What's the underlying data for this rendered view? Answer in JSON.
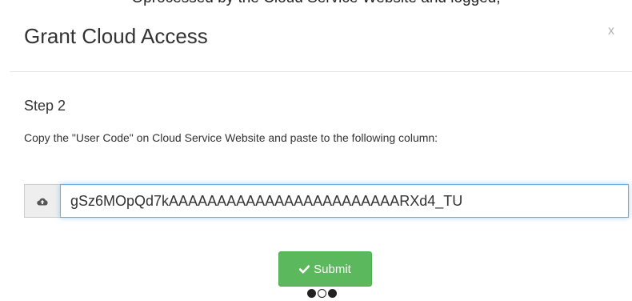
{
  "top_partial_text": "Oprocessed by the Cloud Service Website and logged,",
  "dialog": {
    "title": "Grant Cloud Access",
    "close_label": "x"
  },
  "step": {
    "heading": "Step 2",
    "instructions": "Copy the \"User Code\" on Cloud Service Website and paste to the following column:"
  },
  "code_field": {
    "value": "gSz6MOpQd7kAAAAAAAAAAAAAAAAAAAAAAAARXd4_TU",
    "addon_icon": "cloud-upload-icon"
  },
  "submit": {
    "label": "Submit",
    "icon": "check-icon",
    "color": "#5cb85c"
  },
  "step_indicator": {
    "total": 3,
    "current": 2
  }
}
